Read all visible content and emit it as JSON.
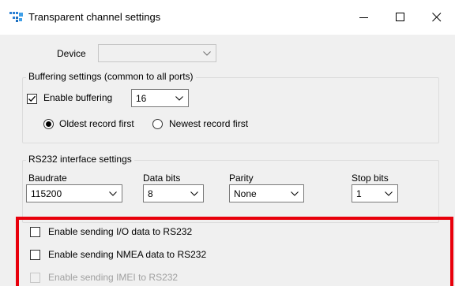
{
  "window": {
    "title": "Transparent channel settings",
    "controls": {
      "minimize": "minimize",
      "maximize": "maximize",
      "close": "close"
    }
  },
  "device": {
    "label": "Device",
    "value": "",
    "enabled": false
  },
  "buffering": {
    "group_title": "Buffering settings (common to all ports)",
    "enable_label": "Enable buffering",
    "enable_checked": true,
    "buffer_value": "16",
    "order_options": [
      {
        "label": "Oldest record first",
        "selected": true
      },
      {
        "label": "Newest record first",
        "selected": false
      }
    ]
  },
  "rs232": {
    "group_title": "RS232 interface settings",
    "fields": {
      "baudrate": {
        "label": "Baudrate",
        "value": "115200"
      },
      "data_bits": {
        "label": "Data bits",
        "value": "8"
      },
      "parity": {
        "label": "Parity",
        "value": "None"
      },
      "stop_bits": {
        "label": "Stop bits",
        "value": "1"
      }
    }
  },
  "sending": {
    "io": {
      "label": "Enable sending I/O data to RS232",
      "checked": false,
      "enabled": true
    },
    "nmea": {
      "label": "Enable sending NMEA data to RS232",
      "checked": false,
      "enabled": true
    },
    "imei": {
      "label": "Enable sending IMEI to RS232",
      "checked": false,
      "enabled": false
    }
  },
  "colors": {
    "highlight": "#e8000b",
    "client_bg": "#f0f0f0",
    "disabled_text": "#a0a0a0"
  }
}
